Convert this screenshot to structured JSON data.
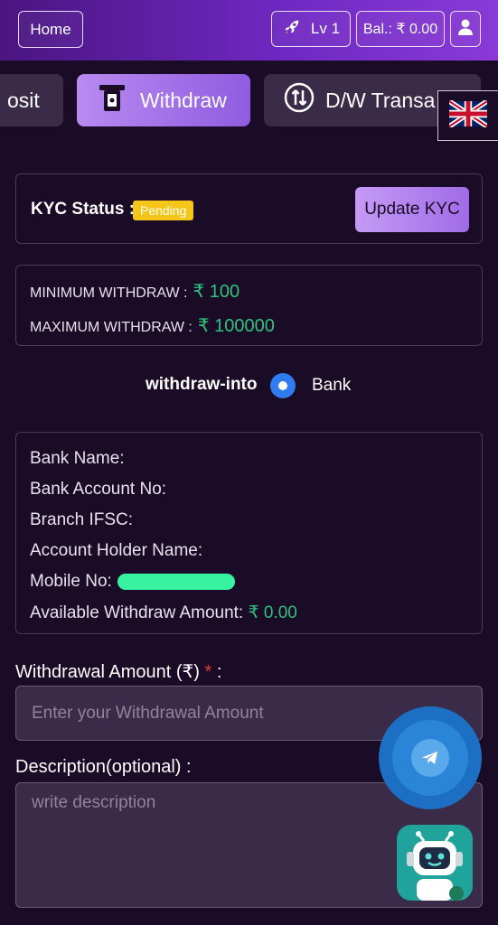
{
  "header": {
    "home_label": "Home",
    "level_label": "Lv 1",
    "balance_label": "Bal.: ₹ 0.00",
    "rocket_icon": "rocket-icon",
    "user_icon": "user-icon",
    "background_color": "#6d28c0"
  },
  "tabs": [
    {
      "label": "osit",
      "icon": "deposit-icon",
      "active": false
    },
    {
      "label": "Withdraw",
      "icon": "atm-withdraw-icon",
      "active": true
    },
    {
      "label": "D/W Transa",
      "icon": "updown-transactions-icon",
      "active": false
    }
  ],
  "language": {
    "icon": "uk-flag-icon"
  },
  "kyc": {
    "label": "KYC Status :",
    "status": "Pending",
    "status_color": "#f5c518",
    "update_label": "Update KYC"
  },
  "limits": {
    "min_label": "MINIMUM WITHDRAW :",
    "min_value": "₹ 100",
    "max_label": "MAXIMUM WITHDRAW :",
    "max_value": "₹ 100000",
    "amount_color": "#2ec27e"
  },
  "withdraw_into": {
    "label": "withdraw-into",
    "option": "Bank",
    "selected": true
  },
  "bank_details": {
    "bank_name_label": "Bank Name:",
    "account_no_label": "Bank Account No:",
    "ifsc_label": "Branch IFSC:",
    "holder_label": "Account Holder Name:",
    "mobile_label": "Mobile No:",
    "available_label": "Available Withdraw Amount:",
    "available_value": "₹ 0.00"
  },
  "form": {
    "amount_label": "Withdrawal Amount (₹)",
    "required_mark": "*",
    "amount_suffix": " :",
    "amount_placeholder": "Enter your Withdrawal Amount",
    "desc_label": "Description",
    "desc_optional": "(optional) :",
    "desc_placeholder": "write description"
  },
  "floating": {
    "telegram_icon": "telegram-icon",
    "bot_icon": "chatbot-icon"
  }
}
